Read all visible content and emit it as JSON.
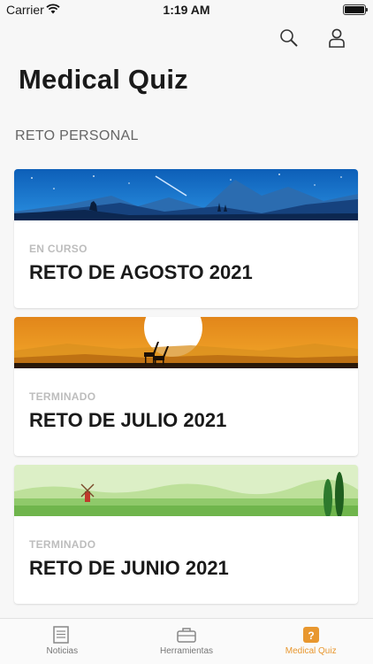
{
  "status_bar": {
    "carrier": "Carrier",
    "time": "1:19 AM"
  },
  "header": {
    "title": "Medical Quiz",
    "search_icon": "search-icon",
    "profile_icon": "user-icon"
  },
  "section": {
    "label": "RETO PERSONAL"
  },
  "challenges": [
    {
      "status": "EN CURSO",
      "name": "RETO DE AGOSTO 2021",
      "banner": "night-mountains"
    },
    {
      "status": "TERMINADO",
      "name": "RETO DE JULIO 2021",
      "banner": "savanna-sunset"
    },
    {
      "status": "TERMINADO",
      "name": "RETO DE JUNIO 2021",
      "banner": "windmill-meadow"
    }
  ],
  "tabs": [
    {
      "label": "Noticias",
      "icon": "newspaper-icon",
      "active": false
    },
    {
      "label": "Herramientas",
      "icon": "toolbox-icon",
      "active": false
    },
    {
      "label": "Medical Quiz",
      "icon": "quiz-icon",
      "active": true
    }
  ],
  "colors": {
    "accent": "#e8972f",
    "inactive": "#777777"
  }
}
